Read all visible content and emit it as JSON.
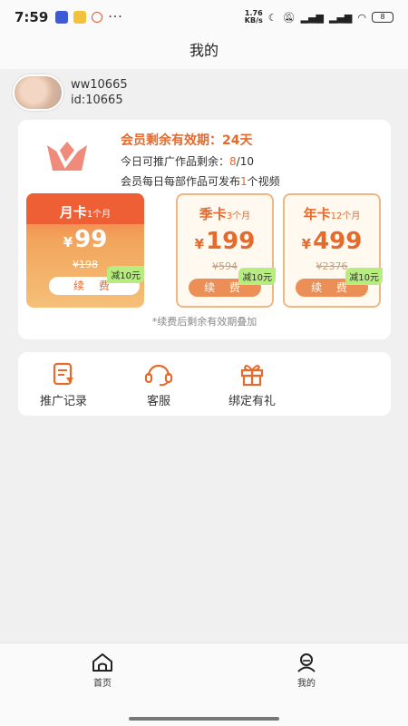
{
  "status_bar": {
    "time": "7:59",
    "net_speed_value": "1.76",
    "net_speed_unit": "KB/s",
    "battery": "8"
  },
  "title": "我的",
  "user": {
    "name": "ww10665",
    "id": "id:10665"
  },
  "vip": {
    "expire_label": "会员剩余有效期：",
    "expire_days": "24天",
    "today_label": "今日可推广作品剩余：",
    "today_used": "8",
    "today_total": "/10",
    "daily_prefix": "会员每日每部作品可发布",
    "daily_count": "1",
    "daily_suffix": "个视频",
    "note": "*续费后剩余有效期叠加",
    "colors": {
      "accent": "#e56a2c",
      "badge": "#b7ec7e"
    }
  },
  "plans": [
    {
      "name": "月卡",
      "period": "1个月",
      "currency": "¥",
      "price": "99",
      "original": "¥198",
      "button": "续 费",
      "badge": "减10元",
      "selected": true
    },
    {
      "name": "季卡",
      "period": "3个月",
      "currency": "¥",
      "price": "199",
      "original": "¥594",
      "button": "续 费",
      "badge": "减10元",
      "selected": false
    },
    {
      "name": "年卡",
      "period": "12个月",
      "currency": "¥",
      "price": "499",
      "original": "¥2376",
      "button": "续 费",
      "badge": "减10元",
      "selected": false
    }
  ],
  "functions": [
    {
      "label": "推广记录",
      "icon": "document-icon"
    },
    {
      "label": "客服",
      "icon": "headset-icon"
    },
    {
      "label": "绑定有礼",
      "icon": "gift-icon"
    }
  ],
  "nav": [
    {
      "label": "首页",
      "icon": "home-icon"
    },
    {
      "label": "我的",
      "icon": "profile-icon"
    }
  ]
}
